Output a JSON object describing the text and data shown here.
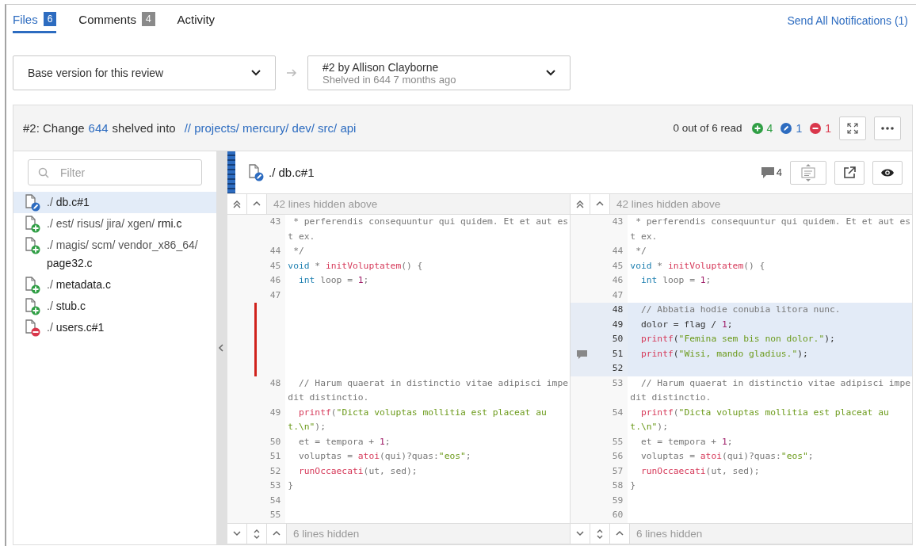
{
  "tabs": [
    {
      "label": "Files",
      "count": "6",
      "selected": true
    },
    {
      "label": "Comments",
      "count": "4",
      "selected": false
    },
    {
      "label": "Activity",
      "selected": false
    }
  ],
  "notify_link": "Send All Notifications (1)",
  "version_selects": [
    {
      "title": "Base version for this review"
    },
    {
      "title": "#2 by Allison Clayborne",
      "subtitle": "Shelved in 644 7 months ago"
    }
  ],
  "review": {
    "title_prefix": "#2: Change",
    "change": "644",
    "title_mid": "shelved into",
    "path": "// projects/ mercury/ dev/ src/ api",
    "read_status": "0 out of 6 read",
    "counts": [
      {
        "kind": "added",
        "count": "4"
      },
      {
        "kind": "edited",
        "count": "1"
      },
      {
        "kind": "deleted",
        "count": "1"
      }
    ]
  },
  "filter": {
    "placeholder": "Filter"
  },
  "files": [
    {
      "path": "./",
      "name": "db.c#1",
      "kind": "edited",
      "selected": true
    },
    {
      "path": "./ est/ risus/ jira/ xgen/",
      "name": "rmi.c",
      "kind": "added",
      "selected": false
    },
    {
      "path": "./ magis/ scm/ vendor_x86_64/",
      "name": "page32.c",
      "kind": "added",
      "selected": false
    },
    {
      "path": "./",
      "name": "metadata.c",
      "kind": "added",
      "selected": false
    },
    {
      "path": "./",
      "name": "stub.c",
      "kind": "added",
      "selected": false
    },
    {
      "path": "./",
      "name": "users.c#1",
      "kind": "deleted",
      "selected": false
    }
  ],
  "diff": {
    "path": "./",
    "name": "db.c#1",
    "kind": "edited",
    "comment_count": "4",
    "panes": [
      {
        "hidden_above": "42 lines hidden above",
        "hidden_below": "6 lines hidden",
        "rows": [
          {
            "num": "43",
            "kind": "context",
            "tokens": [
              {
                "kind": "comment",
                "text": " * perferendis consequuntur qui quidem. Et et aut est ex."
              }
            ]
          },
          {
            "num": "44",
            "kind": "context",
            "tokens": [
              {
                "kind": "comment",
                "text": " */"
              }
            ]
          },
          {
            "num": "45",
            "kind": "context",
            "tokens": [
              {
                "kind": "keyword",
                "text": "void"
              },
              {
                "kind": "plain",
                "text": " * "
              },
              {
                "kind": "func",
                "text": "initVoluptatem"
              },
              {
                "kind": "plain",
                "text": "() {"
              }
            ]
          },
          {
            "num": "46",
            "kind": "context",
            "tokens": [
              {
                "kind": "keyword",
                "text": "  int"
              },
              {
                "kind": "plain",
                "text": " loop = "
              },
              {
                "kind": "number",
                "text": "1"
              },
              {
                "kind": "plain",
                "text": ";"
              }
            ]
          },
          {
            "num": "47",
            "kind": "context"
          },
          {
            "kind": "gap"
          },
          {
            "kind": "gap"
          },
          {
            "kind": "gap"
          },
          {
            "kind": "gap"
          },
          {
            "kind": "gap"
          },
          {
            "num": "48",
            "kind": "context",
            "tokens": [
              {
                "kind": "comment",
                "text": "  // Harum quaerat in distinctio vitae adipisci impedit distinctio."
              }
            ]
          },
          {
            "num": "49",
            "kind": "context",
            "tokens": [
              {
                "kind": "func",
                "text": "  printf"
              },
              {
                "kind": "plain",
                "text": "("
              },
              {
                "kind": "string",
                "text": "\"Dicta voluptas mollitia est placeat aut.\\n\""
              },
              {
                "kind": "plain",
                "text": ");"
              }
            ]
          },
          {
            "num": "50",
            "kind": "context",
            "tokens": [
              {
                "kind": "plain",
                "text": "  et = tempora + "
              },
              {
                "kind": "number",
                "text": "1"
              },
              {
                "kind": "plain",
                "text": ";"
              }
            ]
          },
          {
            "num": "51",
            "kind": "context",
            "tokens": [
              {
                "kind": "plain",
                "text": "  voluptas = "
              },
              {
                "kind": "func",
                "text": "atoi"
              },
              {
                "kind": "plain",
                "text": "(qui)?quas:"
              },
              {
                "kind": "string",
                "text": "\"eos\""
              },
              {
                "kind": "plain",
                "text": ";"
              }
            ]
          },
          {
            "num": "52",
            "kind": "context",
            "tokens": [
              {
                "kind": "func",
                "text": "  runOccaecati"
              },
              {
                "kind": "plain",
                "text": "(ut, sed);"
              }
            ]
          },
          {
            "num": "53",
            "kind": "context",
            "tokens": [
              {
                "kind": "plain",
                "text": "}"
              }
            ]
          },
          {
            "num": "54",
            "kind": "context"
          },
          {
            "num": "55",
            "kind": "context"
          }
        ]
      },
      {
        "hidden_above": "42 lines hidden above",
        "hidden_below": "6 lines hidden",
        "rows": [
          {
            "num": "43",
            "kind": "context",
            "tokens": [
              {
                "kind": "comment",
                "text": " * perferendis consequuntur qui quidem. Et et aut est ex."
              }
            ]
          },
          {
            "num": "44",
            "kind": "context",
            "tokens": [
              {
                "kind": "comment",
                "text": " */"
              }
            ]
          },
          {
            "num": "45",
            "kind": "context",
            "tokens": [
              {
                "kind": "keyword",
                "text": "void"
              },
              {
                "kind": "plain",
                "text": " * "
              },
              {
                "kind": "func",
                "text": "initVoluptatem"
              },
              {
                "kind": "plain",
                "text": "() {"
              }
            ]
          },
          {
            "num": "46",
            "kind": "context",
            "tokens": [
              {
                "kind": "keyword",
                "text": "  int"
              },
              {
                "kind": "plain",
                "text": " loop = "
              },
              {
                "kind": "number",
                "text": "1"
              },
              {
                "kind": "plain",
                "text": ";"
              }
            ]
          },
          {
            "num": "47",
            "kind": "context"
          },
          {
            "num": "48",
            "kind": "added",
            "tokens": [
              {
                "kind": "comment",
                "text": "  // Abbatia hodie conubia litora nunc."
              }
            ]
          },
          {
            "num": "49",
            "kind": "added",
            "tokens": [
              {
                "kind": "plain",
                "text": "  dolor = flag / "
              },
              {
                "kind": "number",
                "text": "1"
              },
              {
                "kind": "plain",
                "text": ";"
              }
            ]
          },
          {
            "num": "50",
            "kind": "added",
            "tokens": [
              {
                "kind": "func",
                "text": "  printf"
              },
              {
                "kind": "plain",
                "text": "("
              },
              {
                "kind": "string",
                "text": "\"Femina sem bis non dolor.\""
              },
              {
                "kind": "plain",
                "text": ");"
              }
            ]
          },
          {
            "num": "51",
            "kind": "added",
            "comment": true,
            "tokens": [
              {
                "kind": "func",
                "text": "  printf"
              },
              {
                "kind": "plain",
                "text": "("
              },
              {
                "kind": "string",
                "text": "\"Wisi, mando gladius.\""
              },
              {
                "kind": "plain",
                "text": ");"
              }
            ]
          },
          {
            "num": "52",
            "kind": "added"
          },
          {
            "num": "53",
            "kind": "context",
            "tokens": [
              {
                "kind": "comment",
                "text": "  // Harum quaerat in distinctio vitae adipisci impedit distinctio."
              }
            ]
          },
          {
            "num": "54",
            "kind": "context",
            "tokens": [
              {
                "kind": "func",
                "text": "  printf"
              },
              {
                "kind": "plain",
                "text": "("
              },
              {
                "kind": "string",
                "text": "\"Dicta voluptas mollitia est placeat aut.\\n\""
              },
              {
                "kind": "plain",
                "text": ");"
              }
            ]
          },
          {
            "num": "55",
            "kind": "context",
            "tokens": [
              {
                "kind": "plain",
                "text": "  et = tempora + "
              },
              {
                "kind": "number",
                "text": "1"
              },
              {
                "kind": "plain",
                "text": ";"
              }
            ]
          },
          {
            "num": "56",
            "kind": "context",
            "tokens": [
              {
                "kind": "plain",
                "text": "  voluptas = "
              },
              {
                "kind": "func",
                "text": "atoi"
              },
              {
                "kind": "plain",
                "text": "(qui)?quas:"
              },
              {
                "kind": "string",
                "text": "\"eos\""
              },
              {
                "kind": "plain",
                "text": ";"
              }
            ]
          },
          {
            "num": "57",
            "kind": "context",
            "tokens": [
              {
                "kind": "func",
                "text": "  runOccaecati"
              },
              {
                "kind": "plain",
                "text": "(ut, sed);"
              }
            ]
          },
          {
            "num": "58",
            "kind": "context",
            "tokens": [
              {
                "kind": "plain",
                "text": "}"
              }
            ]
          },
          {
            "num": "59",
            "kind": "context"
          },
          {
            "num": "60",
            "kind": "context"
          }
        ]
      }
    ]
  }
}
